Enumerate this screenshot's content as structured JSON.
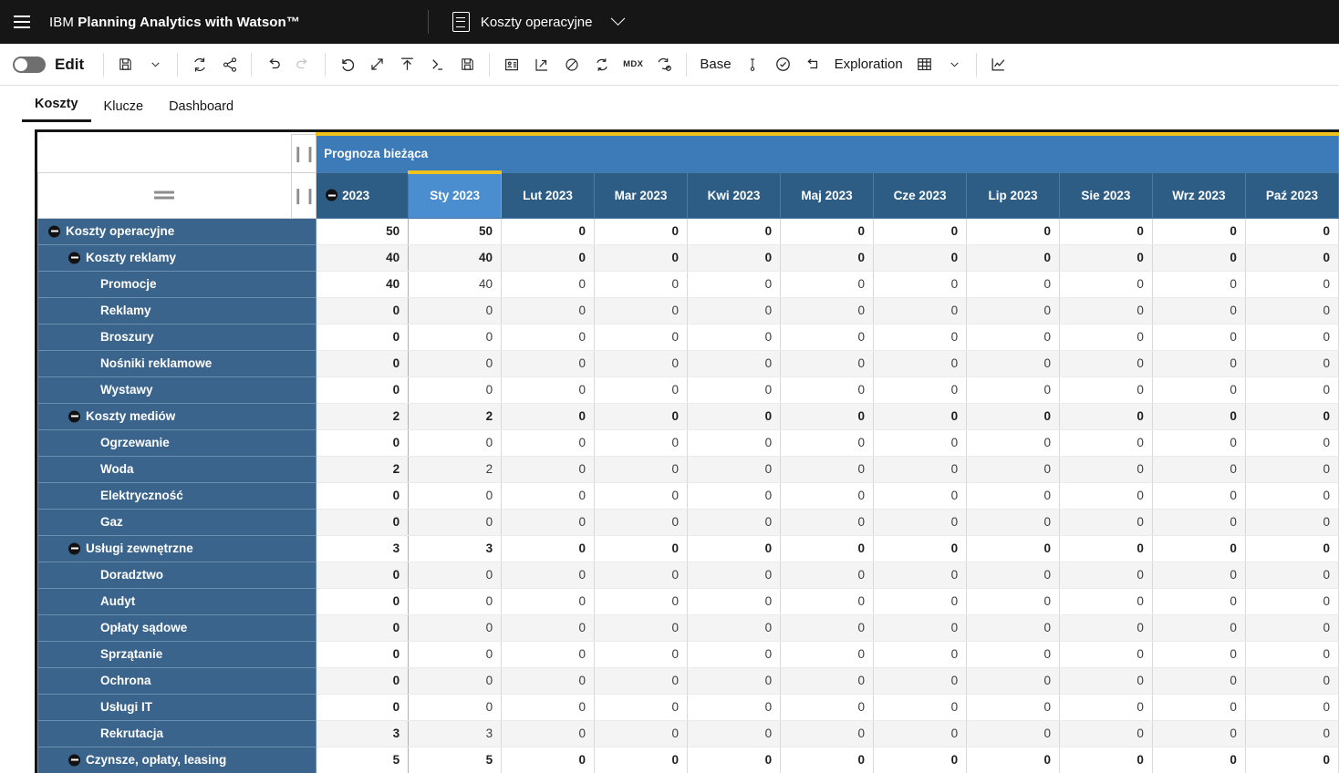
{
  "topbar": {
    "menu_icon": "hamburger-icon",
    "brand_prefix": "IBM",
    "brand_name": "Planning Analytics with Watson™",
    "cube_icon": "cube-view-icon",
    "cube_name": "Koszty operacyjne",
    "cube_chevron": "chevron-down-icon"
  },
  "toolbar": {
    "edit_toggle_state": "off",
    "edit_label": "Edit",
    "base_label": "Base",
    "exploration_label": "Exploration",
    "mdx_label": "MDX",
    "icons": [
      "save-icon",
      "chevron-down-icon",
      "refresh-icon",
      "share-icon",
      "undo-icon",
      "redo-icon",
      "reset-icon",
      "expand-icon",
      "upload-icon",
      "console-icon",
      "save-view-icon",
      "details-icon",
      "resize-icon",
      "suppress-zero-icon",
      "recalculate-icon",
      "mdx-icon",
      "sync-settings-icon",
      "sandbox-icon",
      "commit-icon",
      "rollback-icon",
      "grid-icon",
      "chevron-down-icon",
      "chart-icon"
    ]
  },
  "tabs": [
    {
      "label": "Koszty",
      "active": true
    },
    {
      "label": "Klucze",
      "active": false
    },
    {
      "label": "Dashboard",
      "active": false
    }
  ],
  "grid": {
    "band_label": "Prognoza bieżąca",
    "splitter_glyph": "❙❙",
    "row_handle_glyph": "drag-handle-icon",
    "total_column": {
      "label": "2023",
      "collapsible": true
    },
    "columns": [
      {
        "label": "Sty 2023",
        "selected": true
      },
      {
        "label": "Lut 2023",
        "selected": false
      },
      {
        "label": "Mar 2023",
        "selected": false
      },
      {
        "label": "Kwi 2023",
        "selected": false
      },
      {
        "label": "Maj 2023",
        "selected": false
      },
      {
        "label": "Cze 2023",
        "selected": false
      },
      {
        "label": "Lip 2023",
        "selected": false
      },
      {
        "label": "Sie 2023",
        "selected": false
      },
      {
        "label": "Wrz 2023",
        "selected": false
      },
      {
        "label": "Paź 2023",
        "selected": false
      }
    ],
    "rows": [
      {
        "label": "Koszty operacyjne",
        "level": 0,
        "consolidated": true,
        "total": "50",
        "values": [
          "50",
          "0",
          "0",
          "0",
          "0",
          "0",
          "0",
          "0",
          "0",
          "0"
        ]
      },
      {
        "label": "Koszty reklamy",
        "level": 1,
        "consolidated": true,
        "total": "40",
        "values": [
          "40",
          "0",
          "0",
          "0",
          "0",
          "0",
          "0",
          "0",
          "0",
          "0"
        ]
      },
      {
        "label": "Promocje",
        "level": 2,
        "consolidated": false,
        "total": "40",
        "values": [
          "40",
          "0",
          "0",
          "0",
          "0",
          "0",
          "0",
          "0",
          "0",
          "0"
        ]
      },
      {
        "label": "Reklamy",
        "level": 2,
        "consolidated": false,
        "total": "0",
        "values": [
          "0",
          "0",
          "0",
          "0",
          "0",
          "0",
          "0",
          "0",
          "0",
          "0"
        ]
      },
      {
        "label": "Broszury",
        "level": 2,
        "consolidated": false,
        "total": "0",
        "values": [
          "0",
          "0",
          "0",
          "0",
          "0",
          "0",
          "0",
          "0",
          "0",
          "0"
        ]
      },
      {
        "label": "Nośniki reklamowe",
        "level": 2,
        "consolidated": false,
        "total": "0",
        "values": [
          "0",
          "0",
          "0",
          "0",
          "0",
          "0",
          "0",
          "0",
          "0",
          "0"
        ]
      },
      {
        "label": "Wystawy",
        "level": 2,
        "consolidated": false,
        "total": "0",
        "values": [
          "0",
          "0",
          "0",
          "0",
          "0",
          "0",
          "0",
          "0",
          "0",
          "0"
        ]
      },
      {
        "label": "Koszty mediów",
        "level": 1,
        "consolidated": true,
        "total": "2",
        "values": [
          "2",
          "0",
          "0",
          "0",
          "0",
          "0",
          "0",
          "0",
          "0",
          "0"
        ]
      },
      {
        "label": "Ogrzewanie",
        "level": 2,
        "consolidated": false,
        "total": "0",
        "values": [
          "0",
          "0",
          "0",
          "0",
          "0",
          "0",
          "0",
          "0",
          "0",
          "0"
        ]
      },
      {
        "label": "Woda",
        "level": 2,
        "consolidated": false,
        "total": "2",
        "values": [
          "2",
          "0",
          "0",
          "0",
          "0",
          "0",
          "0",
          "0",
          "0",
          "0"
        ]
      },
      {
        "label": "Elektryczność",
        "level": 2,
        "consolidated": false,
        "total": "0",
        "values": [
          "0",
          "0",
          "0",
          "0",
          "0",
          "0",
          "0",
          "0",
          "0",
          "0"
        ]
      },
      {
        "label": "Gaz",
        "level": 2,
        "consolidated": false,
        "total": "0",
        "values": [
          "0",
          "0",
          "0",
          "0",
          "0",
          "0",
          "0",
          "0",
          "0",
          "0"
        ]
      },
      {
        "label": "Usługi zewnętrzne",
        "level": 1,
        "consolidated": true,
        "total": "3",
        "values": [
          "3",
          "0",
          "0",
          "0",
          "0",
          "0",
          "0",
          "0",
          "0",
          "0"
        ]
      },
      {
        "label": "Doradztwo",
        "level": 2,
        "consolidated": false,
        "total": "0",
        "values": [
          "0",
          "0",
          "0",
          "0",
          "0",
          "0",
          "0",
          "0",
          "0",
          "0"
        ]
      },
      {
        "label": "Audyt",
        "level": 2,
        "consolidated": false,
        "total": "0",
        "values": [
          "0",
          "0",
          "0",
          "0",
          "0",
          "0",
          "0",
          "0",
          "0",
          "0"
        ]
      },
      {
        "label": "Opłaty sądowe",
        "level": 2,
        "consolidated": false,
        "total": "0",
        "values": [
          "0",
          "0",
          "0",
          "0",
          "0",
          "0",
          "0",
          "0",
          "0",
          "0"
        ]
      },
      {
        "label": "Sprzątanie",
        "level": 2,
        "consolidated": false,
        "total": "0",
        "values": [
          "0",
          "0",
          "0",
          "0",
          "0",
          "0",
          "0",
          "0",
          "0",
          "0"
        ]
      },
      {
        "label": "Ochrona",
        "level": 2,
        "consolidated": false,
        "total": "0",
        "values": [
          "0",
          "0",
          "0",
          "0",
          "0",
          "0",
          "0",
          "0",
          "0",
          "0"
        ]
      },
      {
        "label": "Usługi IT",
        "level": 2,
        "consolidated": false,
        "total": "0",
        "values": [
          "0",
          "0",
          "0",
          "0",
          "0",
          "0",
          "0",
          "0",
          "0",
          "0"
        ]
      },
      {
        "label": "Rekrutacja",
        "level": 2,
        "consolidated": false,
        "total": "3",
        "values": [
          "3",
          "0",
          "0",
          "0",
          "0",
          "0",
          "0",
          "0",
          "0",
          "0"
        ]
      },
      {
        "label": "Czynsze, opłaty, leasing",
        "level": 1,
        "consolidated": true,
        "total": "5",
        "values": [
          "5",
          "0",
          "0",
          "0",
          "0",
          "0",
          "0",
          "0",
          "0",
          "0"
        ]
      }
    ]
  },
  "colors": {
    "topbar_bg": "#161616",
    "band_blue": "#3c7ab8",
    "header_blue": "#2d5c85",
    "selected_blue": "#4a8ed0",
    "rowheader_blue": "#3a648c",
    "accent_yellow": "#f1c21b",
    "stripe_gray": "#f4f4f4"
  }
}
